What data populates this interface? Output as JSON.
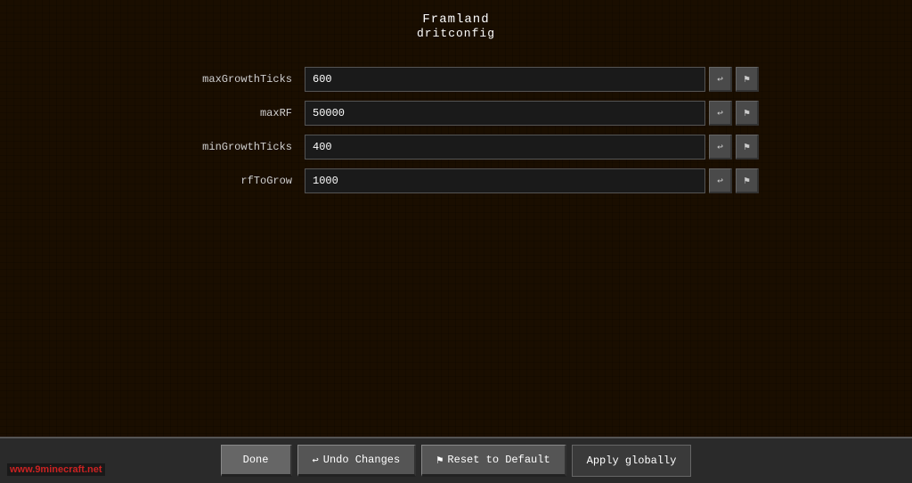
{
  "header": {
    "title_line1": "Framland",
    "title_line2": "dritconfig"
  },
  "config_fields": [
    {
      "label": "maxGrowthTicks",
      "value": "600"
    },
    {
      "label": "maxRF",
      "value": "50000"
    },
    {
      "label": "minGrowthTicks",
      "value": "400"
    },
    {
      "label": "rfToGrow",
      "value": "1000"
    }
  ],
  "buttons": {
    "small_reset_icon": "↩",
    "small_arrow_icon": "↓",
    "done_label": "Done",
    "undo_label": "Undo Changes",
    "reset_label": "Reset to Default",
    "apply_label": "Apply globally",
    "undo_icon": "↩",
    "reset_icon": "⚑"
  },
  "watermark": "www.9minecraft.net"
}
